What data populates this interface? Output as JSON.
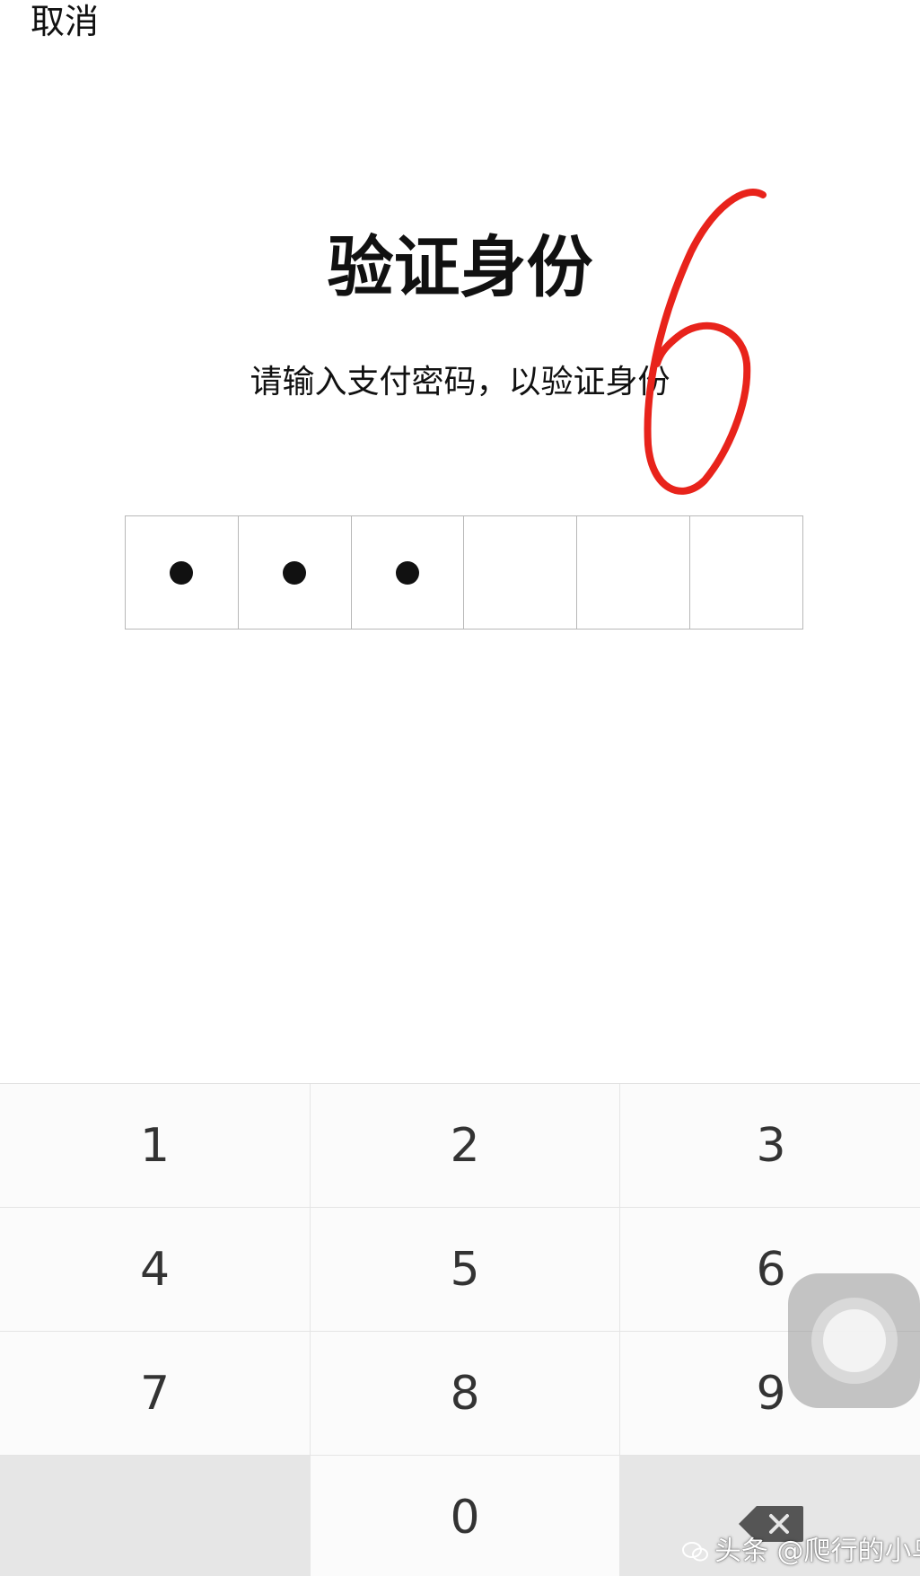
{
  "header": {
    "cancel_label": "取消"
  },
  "main": {
    "title": "验证身份",
    "subtitle": "请输入支付密码，以验证身份",
    "pin": {
      "length": 6,
      "filled": 3
    }
  },
  "annotation": {
    "text": "6",
    "color": "#e8231b"
  },
  "keypad": {
    "keys": [
      "1",
      "2",
      "3",
      "4",
      "5",
      "6",
      "7",
      "8",
      "9",
      "",
      "0",
      "backspace"
    ],
    "backspace_icon": "backspace-icon"
  },
  "overlay": {
    "assistive_touch_icon": "assistive-touch-icon"
  },
  "watermark": {
    "text": "头条 @爬行的小乌龟",
    "icon": "wechat-icon"
  },
  "colors": {
    "background": "#ffffff",
    "text": "#111111",
    "key_background": "#fbfbfb",
    "function_key_background": "#e6e6e6",
    "annotation": "#e8231b"
  }
}
